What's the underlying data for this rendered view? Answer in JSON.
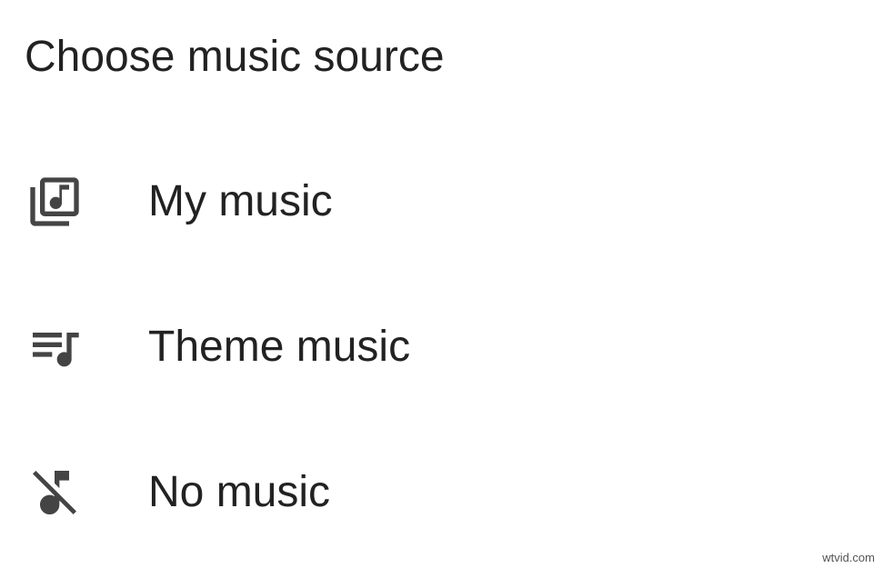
{
  "dialog": {
    "title": "Choose music source",
    "options": [
      {
        "label": "My music",
        "icon": "music-library-icon"
      },
      {
        "label": "Theme music",
        "icon": "playlist-music-icon"
      },
      {
        "label": "No music",
        "icon": "music-off-icon"
      }
    ]
  },
  "watermark": "wtvid.com",
  "colors": {
    "text": "#222222",
    "icon": "#444444",
    "background": "#ffffff"
  }
}
